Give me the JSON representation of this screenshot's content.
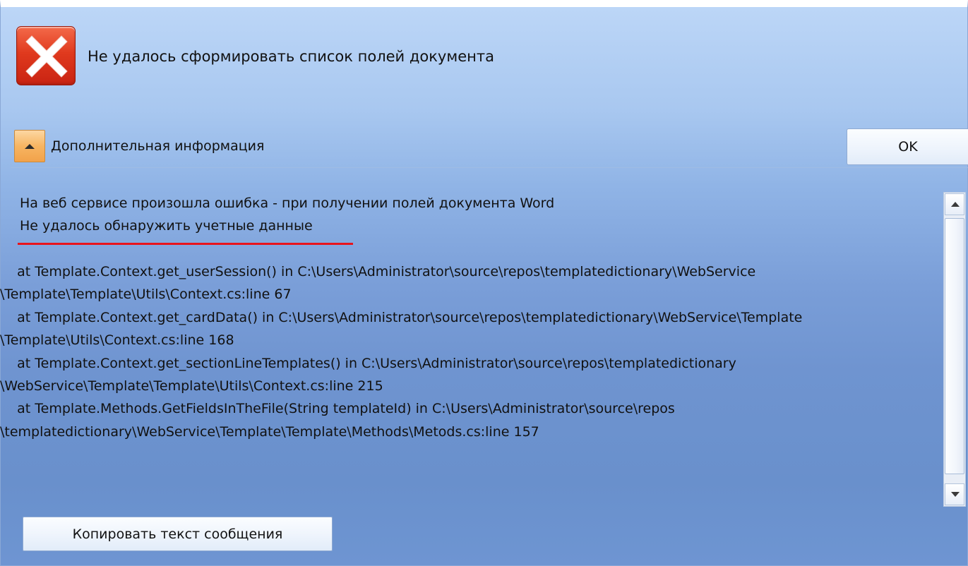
{
  "dialog": {
    "title": "Не удалось сформировать список полей документа",
    "icon": "error-icon"
  },
  "details": {
    "toggle_label": "Дополнительная информация",
    "toggle_icon": "chevron-up-icon",
    "message_line_1": "На веб сервисе произошла ошибка - при получении полей документа Word",
    "message_line_2": "Не удалось обнаружить учетные данные",
    "stack_trace": [
      "    at Template.Context.get_userSession() in C:\\Users\\Administrator\\source\\repos\\templatedictionary\\WebService",
      "\\Template\\Template\\Utils\\Context.cs:line 67",
      "    at Template.Context.get_cardData() in C:\\Users\\Administrator\\source\\repos\\templatedictionary\\WebService\\Template",
      "\\Template\\Utils\\Context.cs:line 168",
      "    at Template.Context.get_sectionLineTemplates() in C:\\Users\\Administrator\\source\\repos\\templatedictionary",
      "\\WebService\\Template\\Template\\Utils\\Context.cs:line 215",
      "    at Template.Methods.GetFieldsInTheFile(String templateId) in C:\\Users\\Administrator\\source\\repos",
      "\\templatedictionary\\WebService\\Template\\Template\\Methods\\Metods.cs:line 157"
    ]
  },
  "buttons": {
    "ok_label": "OK",
    "copy_label": "Копировать текст сообщения"
  },
  "colors": {
    "error_red": "#e03a1e",
    "highlight_underline": "#e8141c",
    "expander_orange": "#f7b562"
  }
}
